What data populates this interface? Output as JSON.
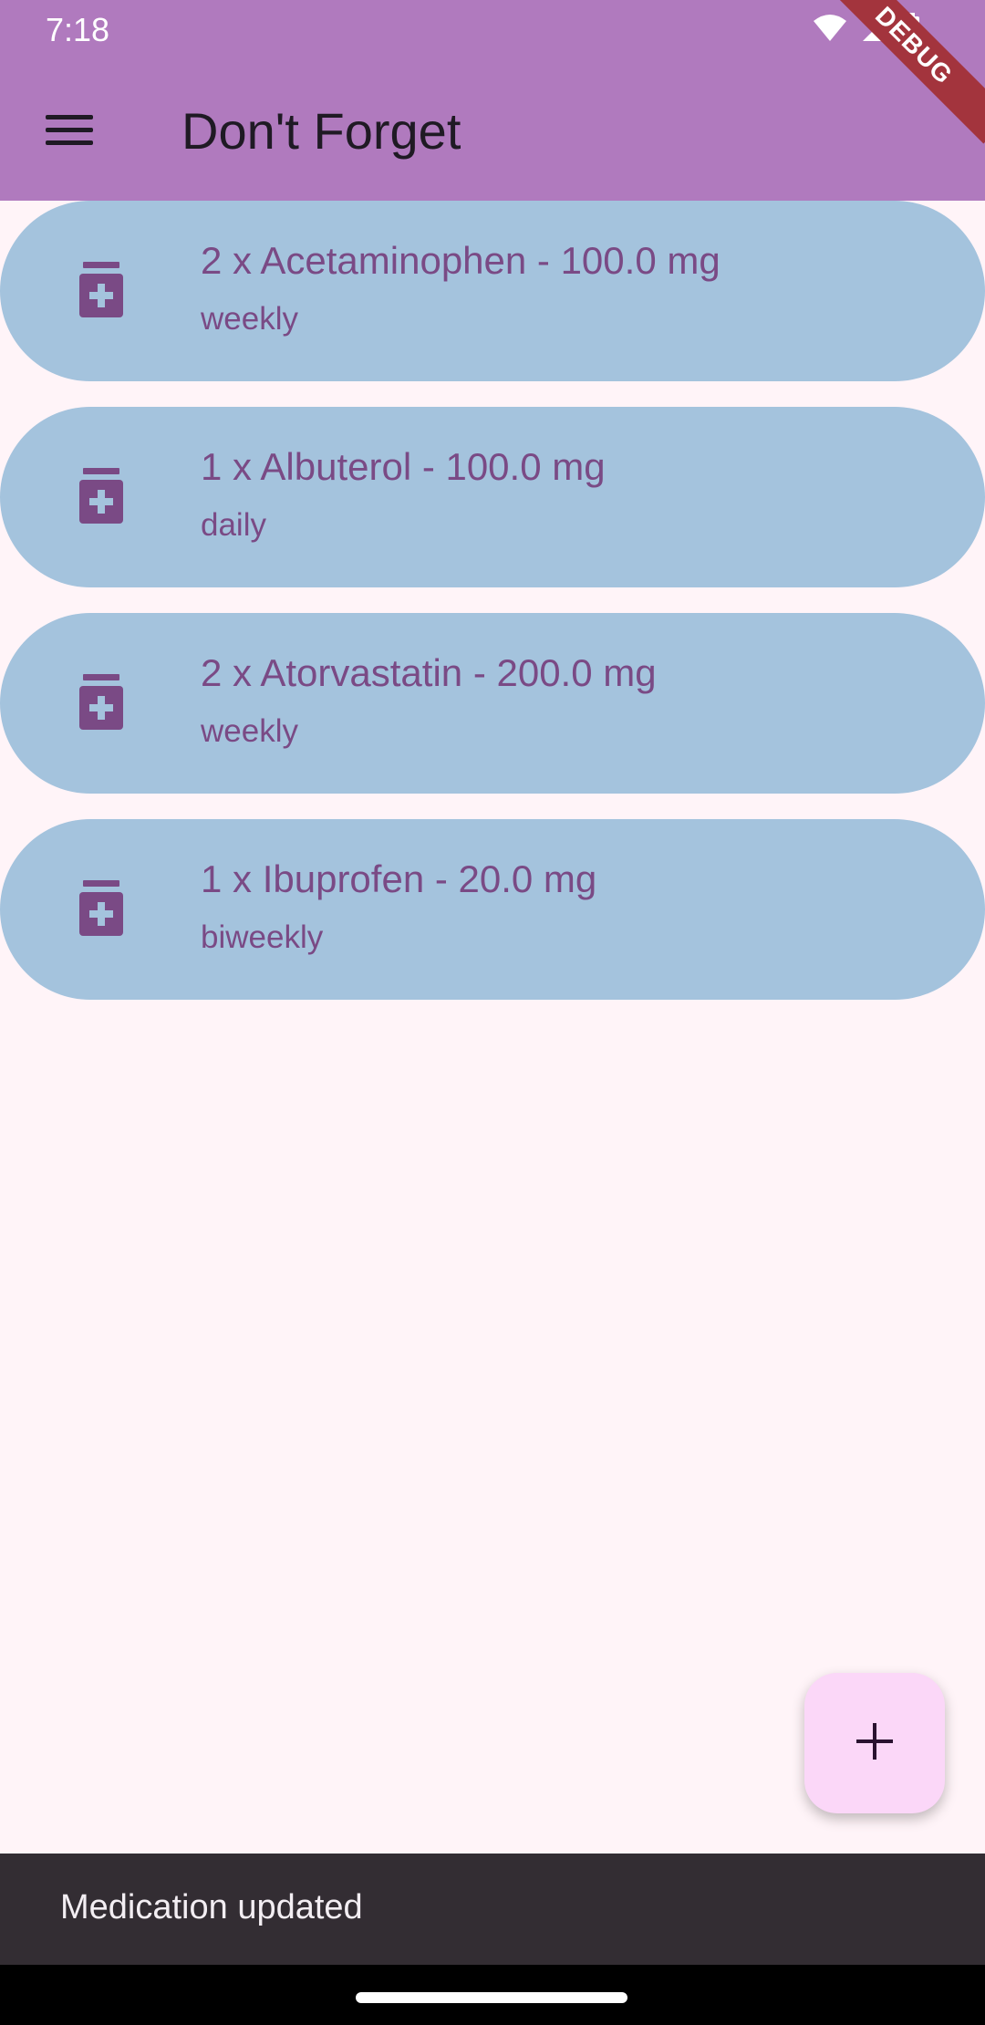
{
  "status_bar": {
    "time": "7:18",
    "icons": [
      "wifi-icon",
      "cellular-signal-icon",
      "battery-icon"
    ]
  },
  "debug_banner": "DEBUG",
  "app_bar": {
    "title": "Don't Forget",
    "menu_icon": "menu-icon"
  },
  "medications": [
    {
      "title": "2 x Acetaminophen - 100.0 mg",
      "frequency": "weekly"
    },
    {
      "title": "1 x Albuterol - 100.0 mg",
      "frequency": "daily"
    },
    {
      "title": "2 x Atorvastatin - 200.0 mg",
      "frequency": "weekly"
    },
    {
      "title": "1 x Ibuprofen - 20.0 mg",
      "frequency": "biweekly"
    }
  ],
  "fab": {
    "icon": "plus-icon"
  },
  "snackbar": {
    "message": "Medication updated"
  },
  "colors": {
    "app_bar": "#b07abe",
    "background": "#fff4f8",
    "list_item": "#a4c3dd",
    "list_text": "#7a4a85",
    "fab": "#fbd7f8",
    "snackbar": "#332d33",
    "debug_ribbon": "#a3343d"
  }
}
